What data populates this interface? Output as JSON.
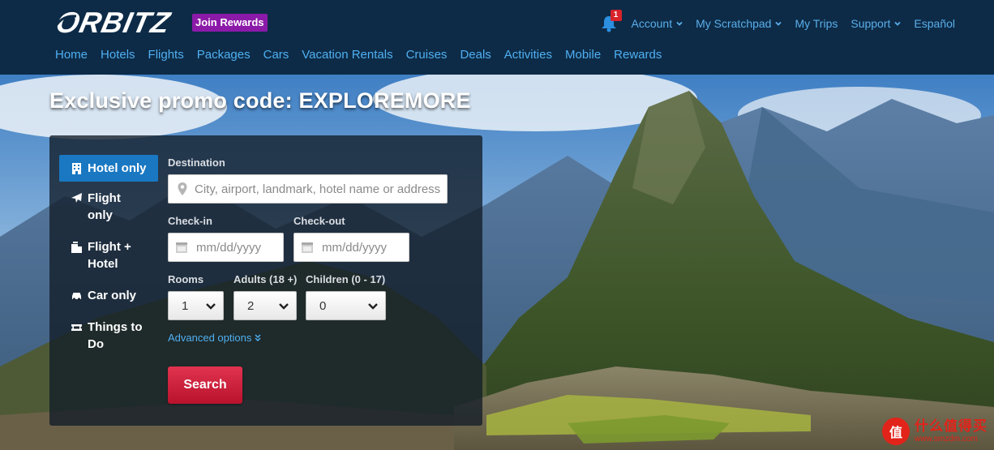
{
  "header": {
    "logo_text": "ORBITZ",
    "join_rewards": "Join Rewards",
    "notification_count": "1",
    "top_links": [
      {
        "label": "Account",
        "dropdown": true
      },
      {
        "label": "My Scratchpad",
        "dropdown": true
      },
      {
        "label": "My Trips",
        "dropdown": false
      },
      {
        "label": "Support",
        "dropdown": true
      },
      {
        "label": "Español",
        "dropdown": false
      }
    ],
    "nav": [
      "Home",
      "Hotels",
      "Flights",
      "Packages",
      "Cars",
      "Vacation Rentals",
      "Cruises",
      "Deals",
      "Activities",
      "Mobile",
      "Rewards"
    ]
  },
  "hero": {
    "promo": "Exclusive promo code: EXPLOREMORE"
  },
  "search": {
    "tabs": [
      {
        "label": "Hotel only",
        "icon": "hotel-icon",
        "active": true
      },
      {
        "label": "Flight only",
        "icon": "airplane-icon",
        "active": false
      },
      {
        "label": "Flight + Hotel",
        "icon": "flight-hotel-icon",
        "active": false
      },
      {
        "label": "Car only",
        "icon": "car-icon",
        "active": false
      },
      {
        "label": "Things to Do",
        "icon": "ticket-icon",
        "active": false
      }
    ],
    "destination_label": "Destination",
    "destination_placeholder": "City, airport, landmark, hotel name or address",
    "checkin_label": "Check-in",
    "checkin_placeholder": "mm/dd/yyyy",
    "checkout_label": "Check-out",
    "checkout_placeholder": "mm/dd/yyyy",
    "rooms_label": "Rooms",
    "rooms_value": "1",
    "adults_label": "Adults (18 +)",
    "adults_value": "2",
    "children_label": "Children (0 - 17)",
    "children_value": "0",
    "advanced_options": "Advanced options",
    "search_button": "Search"
  },
  "watermark": {
    "badge": "值",
    "title": "什么值得买",
    "subtitle": "www.smzdm.com"
  },
  "colors": {
    "header_bg": "#0d2b47",
    "link": "#4fb0f2",
    "active_tab": "#1a78c2",
    "join_rewards": "#8b1aa8",
    "search_button": "#c81a36",
    "badge": "#d8232a"
  }
}
